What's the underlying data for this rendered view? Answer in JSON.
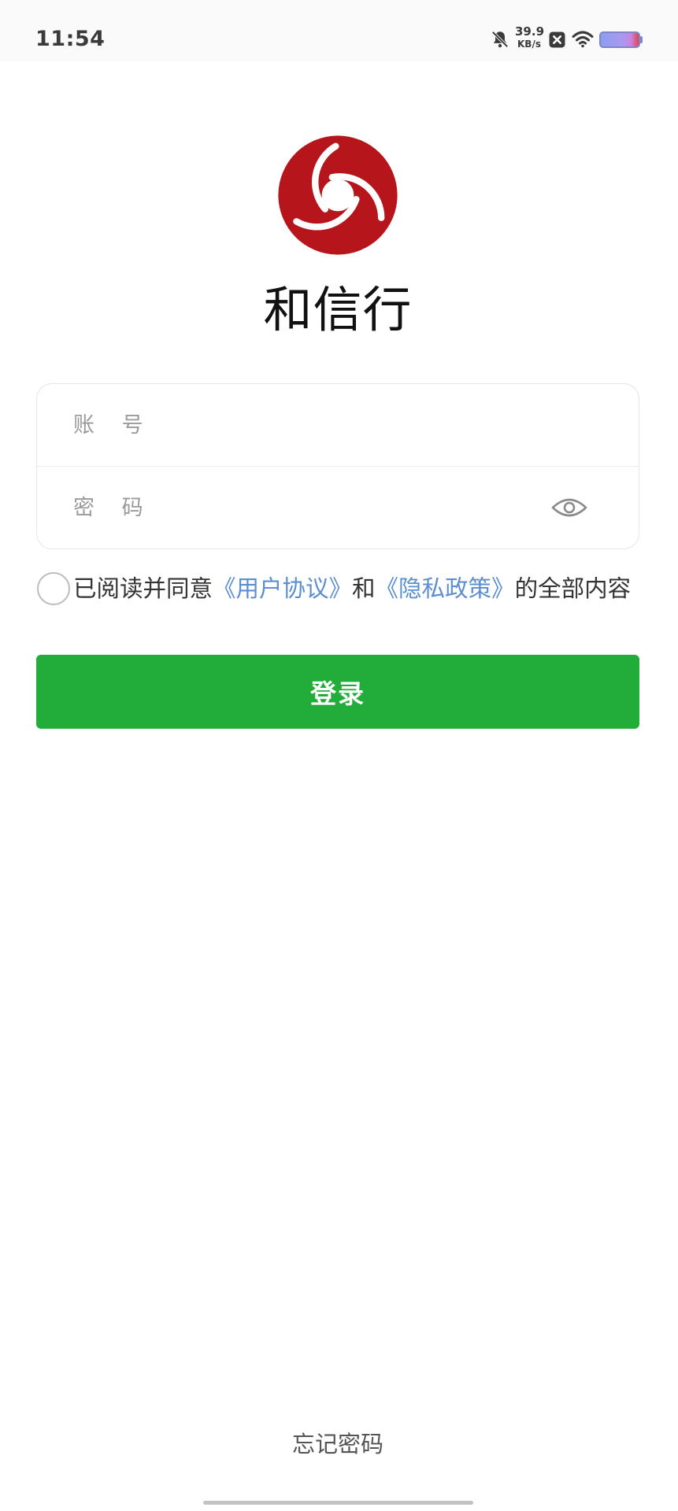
{
  "status_bar": {
    "time": "11:54",
    "net_speed_value": "39.9",
    "net_speed_unit": "KB/s",
    "icons": [
      "bell-mute-icon",
      "notification-x-icon",
      "wifi-icon",
      "battery-icon"
    ]
  },
  "brand": {
    "name": "和信行",
    "logo": "red-swirl-logo",
    "logo_color": "#b5151b"
  },
  "form": {
    "account_placeholder": "账 号",
    "account_value": "",
    "password_placeholder": "密 码",
    "password_value": "",
    "password_toggle_icon": "eye-icon"
  },
  "agreement": {
    "checked": false,
    "prefix": "已阅读并同意",
    "user_agreement": "《用户协议》",
    "conjunction": "和",
    "privacy_policy": "《隐私政策》",
    "suffix": "的全部内容"
  },
  "login_button": {
    "label": "登录"
  },
  "forgot_password": "忘记密码",
  "colors": {
    "primary": "#22ad3a",
    "link": "#5b8fd0",
    "logo_red": "#b5151b",
    "placeholder": "#9a9a9a"
  }
}
